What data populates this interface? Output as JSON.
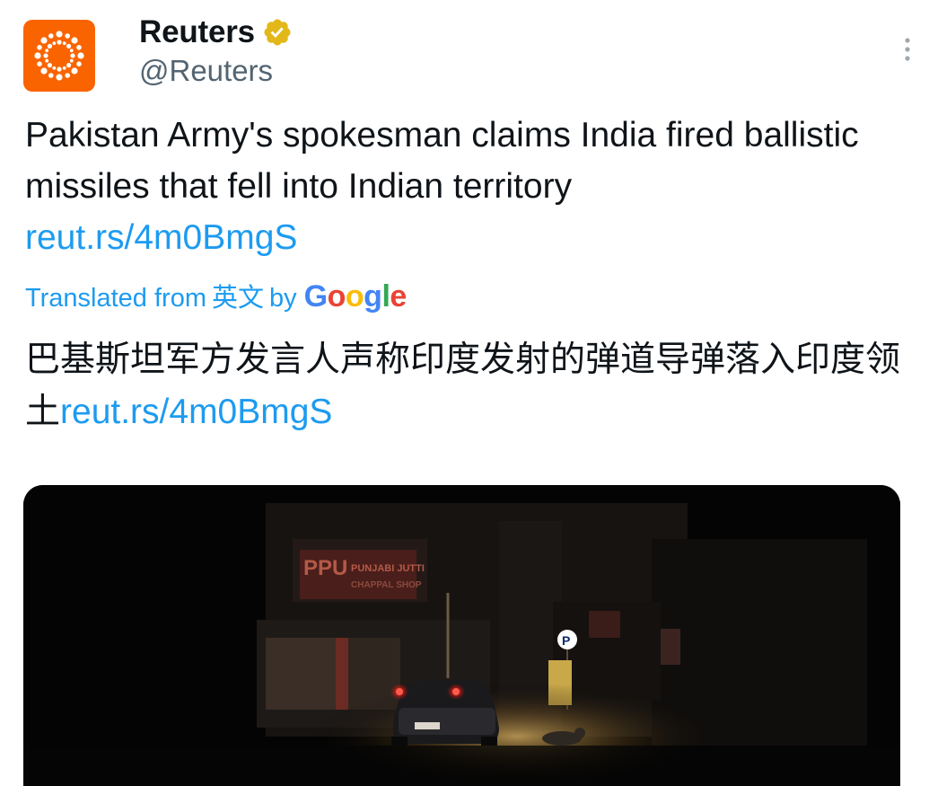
{
  "author": {
    "display_name": "Reuters",
    "handle": "@Reuters",
    "avatar_icon": "reuters-logo-icon",
    "verified_icon": "verified-badge-icon",
    "brand_color": "#fa6400"
  },
  "menu": {
    "icon": "more-vertical-icon"
  },
  "tweet": {
    "text": "Pakistan Army's spokesman claims India fired ballistic missiles that fell into Indian territory",
    "link": "reut.rs/4m0BmgS"
  },
  "translation": {
    "prefix": "Translated from",
    "language": "英文",
    "by": "by",
    "provider": "Google",
    "text": "巴基斯坦军方发言人声称印度发射的弹道导弹落入印度领土",
    "link": "reut.rs/4m0BmgS"
  },
  "media": {
    "sign_text": "PPU PUNJABI JUTTI CHAPPAL SHOP",
    "parking_sign": "P"
  },
  "colors": {
    "link": "#1d9bf0",
    "secondary_text": "#536471",
    "primary_text": "#0f1419"
  }
}
